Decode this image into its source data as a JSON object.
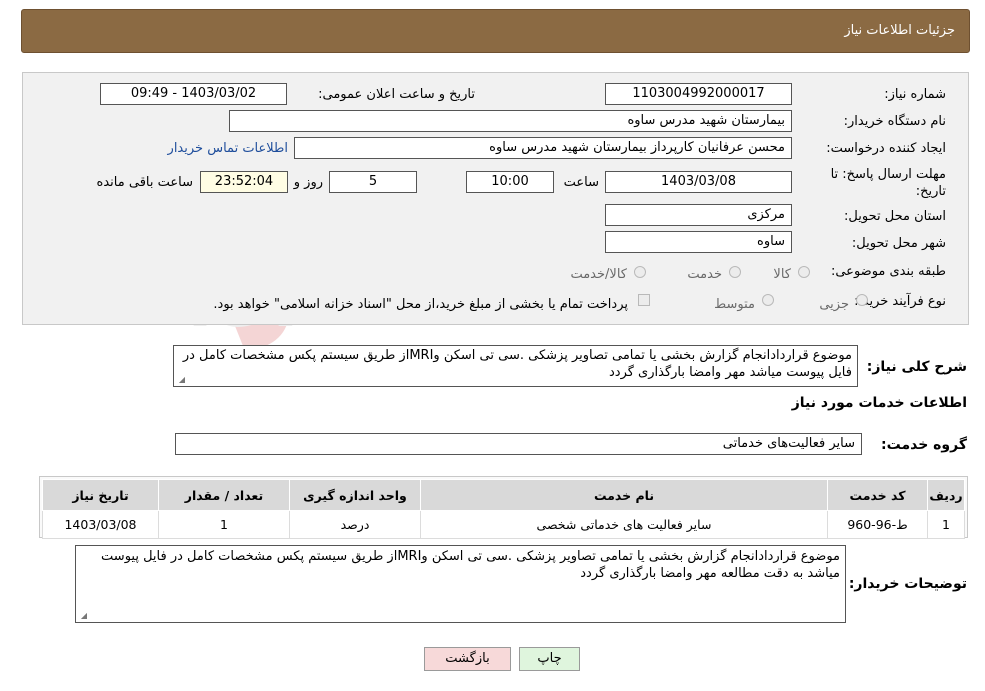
{
  "header": {
    "title": "جزئیات اطلاعات نیاز"
  },
  "form": {
    "need_number": {
      "label": "شماره نیاز:",
      "value": "1103004992000017"
    },
    "announce": {
      "label": "تاریخ و ساعت اعلان عمومی:",
      "value": "1403/03/02 - 09:49"
    },
    "buyer_org": {
      "label": "نام دستگاه خریدار:",
      "value": "بیمارستان شهید مدرس ساوه"
    },
    "requester": {
      "label": "ایجاد کننده درخواست:",
      "value": "محسن عرفانیان کارپرداز بیمارستان شهید مدرس ساوه",
      "contact_link": "اطلاعات تماس خریدار"
    },
    "deadline": {
      "label_line1": "مهلت ارسال پاسخ: تا",
      "label_line2": "تاریخ:",
      "date": "1403/03/08",
      "time_label": "ساعت",
      "time": "10:00",
      "days": "5",
      "days_label": "روز و",
      "remaining": "23:52:04",
      "remaining_label": "ساعت باقی مانده"
    },
    "province": {
      "label": "استان محل تحویل:",
      "value": "مرکزی"
    },
    "city": {
      "label": "شهر محل تحویل:",
      "value": "ساوه"
    },
    "category": {
      "label": "طبقه بندی موضوعی:",
      "options": [
        "کالا",
        "خدمت",
        "کالا/خدمت"
      ]
    },
    "process": {
      "label": "نوع فرآیند خرید :",
      "options": [
        "جزیی",
        "متوسط"
      ],
      "note": "پرداخت تمام یا بخشی از مبلغ خرید،از محل \"اسناد خزانه اسلامی\" خواهد بود."
    }
  },
  "summary": {
    "label": "شرح کلی نیاز:",
    "text": "موضوع قراردادانجام گزارش بخشی یا تمامی تصاویر پزشکی .سی تی اسکن وMRIاز طریق سیستم پکس مشخصات کامل در فایل پیوست میاشد مهر وامضا بارگذاری گردد"
  },
  "services_heading": "اطلاعات خدمات مورد نیاز",
  "service_group": {
    "label": "گروه خدمت:",
    "value": "سایر فعالیت‌های خدماتی"
  },
  "table": {
    "headers": [
      "ردیف",
      "کد خدمت",
      "نام خدمت",
      "واحد اندازه گیری",
      "تعداد / مقدار",
      "تاریخ نیاز"
    ],
    "rows": [
      [
        "1",
        "ط-96-960",
        "سایر فعالیت های خدماتی شخصی",
        "درصد",
        "1",
        "1403/03/08"
      ]
    ]
  },
  "buyer_notes": {
    "label": "توضیحات خریدار:",
    "text": "موضوع قراردادانجام گزارش بخشی یا تمامی تصاویر پزشکی .سی تی اسکن وMRIاز طریق سیستم پکس مشخصات کامل در فایل پیوست میاشد به دقت مطالعه مهر وامضا بارگذاری گردد"
  },
  "buttons": {
    "print": "چاپ",
    "back": "بازگشت"
  },
  "watermark": {
    "text": "AriaTender.neT"
  },
  "colors": {
    "header_bg": "#8b6a43",
    "panel_bg": "#f1f1f1",
    "link": "#1f4e9c",
    "back_button": "#f7d9d9",
    "print_button": "#dff5dd"
  }
}
